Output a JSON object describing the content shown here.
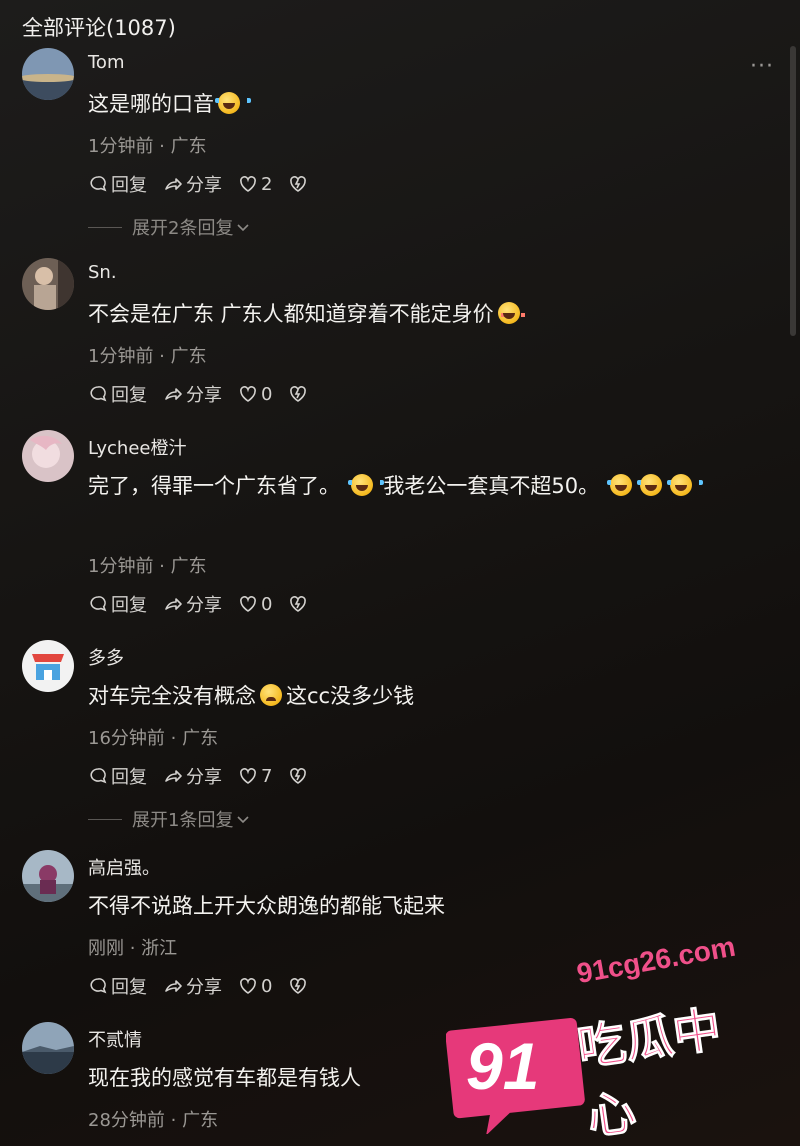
{
  "header": {
    "title": "全部评论(1087)"
  },
  "more_icon": "more-dots-icon",
  "labels": {
    "reply": "回复",
    "share": "分享"
  },
  "comments": [
    {
      "username": "Tom",
      "text": "这是哪的口音",
      "time": "1分钟前",
      "location": "广东",
      "likes": "2",
      "expand": "展开2条回复"
    },
    {
      "username": "Sn.",
      "text": "不会是在广东  广东人都知道穿着不能定身价",
      "time": "1分钟前",
      "location": "广东",
      "likes": "0"
    },
    {
      "username": "Lychee橙汁",
      "text_a": "完了，得罪一个广东省了。",
      "text_b": "我老公一套真不超50。",
      "time": "1分钟前",
      "location": "广东",
      "likes": "0"
    },
    {
      "username": "多多",
      "text_a": "对车完全没有概念",
      "text_b": "这cc没多少钱",
      "time": "16分钟前",
      "location": "广东",
      "likes": "7",
      "expand": "展开1条回复"
    },
    {
      "username": "高启强。",
      "text": "不得不说路上开大众朗逸的都能飞起来",
      "time": "刚刚",
      "location": "浙江",
      "likes": "0"
    },
    {
      "username": "不贰情",
      "text": "现在我的感觉有车都是有钱人",
      "time": "28分钟前",
      "location": "广东"
    }
  ],
  "watermark": {
    "url": "91cg26.com",
    "number": "91",
    "name": "吃瓜中心"
  },
  "colors": {
    "background": "#161412",
    "watermark": "#f0508a",
    "meta": "#9b9894"
  }
}
